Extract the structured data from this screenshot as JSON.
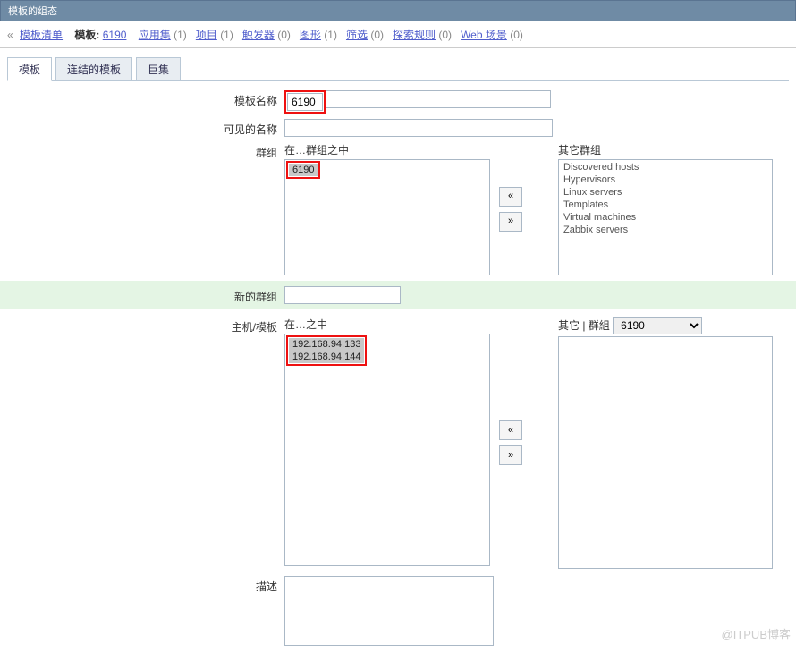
{
  "header": {
    "title": "模板的组态"
  },
  "breadcrumb": {
    "list_link": "模板清单",
    "template_label": "模板:",
    "template_name": "6190",
    "items": [
      {
        "label": "应用集",
        "count": "(1)"
      },
      {
        "label": "项目",
        "count": "(1)"
      },
      {
        "label": "触发器",
        "count": "(0)"
      },
      {
        "label": "图形",
        "count": "(1)"
      },
      {
        "label": "筛选",
        "count": "(0)"
      },
      {
        "label": "探索规则",
        "count": "(0)"
      },
      {
        "label": "Web 场景",
        "count": "(0)"
      }
    ]
  },
  "tabs": {
    "t1": "模板",
    "t2": "连结的模板",
    "t3": "巨集"
  },
  "form": {
    "template_name_label": "模板名称",
    "template_name_value": "6190",
    "visible_name_label": "可见的名称",
    "visible_name_value": "",
    "groups_label": "群组",
    "in_groups_label": "在…群组之中",
    "other_groups_label": "其它群组",
    "in_groups": [
      "6190"
    ],
    "other_groups": [
      "Discovered hosts",
      "Hypervisors",
      "Linux servers",
      "Templates",
      "Virtual machines",
      "Zabbix servers"
    ],
    "new_group_label": "新的群组",
    "new_group_value": "",
    "hosts_label": "主机/模板",
    "in_hosts_label": "在…之中",
    "other_hosts_label": "其它 | 群組",
    "group_select_value": "6190",
    "in_hosts": [
      "192.168.94.133",
      "192.168.94.144"
    ],
    "desc_label": "描述",
    "desc_value": ""
  },
  "arrows": {
    "left": "«",
    "right": "»"
  },
  "watermark": "@ITPUB博客"
}
